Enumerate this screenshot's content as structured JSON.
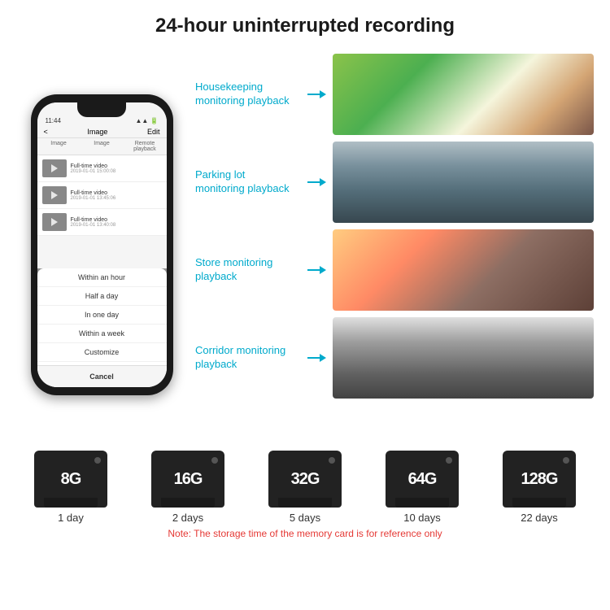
{
  "header": {
    "title": "24-hour uninterrupted recording"
  },
  "phone": {
    "time": "11:44",
    "screen_title": "Image",
    "edit_label": "Edit",
    "back_label": "<",
    "tabs": [
      "Image",
      "Image",
      "Remote playback"
    ],
    "list_items": [
      {
        "label": "Full-time video",
        "date": "2019-01-01 15:00:08"
      },
      {
        "label": "Full-time video",
        "date": "2019-01-01 13:45:06"
      },
      {
        "label": "Full-time video",
        "date": "2019-01-01 13:40:08"
      }
    ],
    "dropdown": {
      "items": [
        "Within an hour",
        "Half a day",
        "In one day",
        "Within a week",
        "Customize"
      ],
      "cancel_label": "Cancel"
    }
  },
  "monitoring": [
    {
      "label": "Housekeeping\nmonitoring playback",
      "img_class": "img-housekeeping"
    },
    {
      "label": "Parking lot\nmonitoring playback",
      "img_class": "img-parking"
    },
    {
      "label": "Store monitoring\nplayback",
      "img_class": "img-store"
    },
    {
      "label": "Corridor monitoring\nplayback",
      "img_class": "img-corridor"
    }
  ],
  "cards": [
    {
      "size": "8G",
      "days": "1 day"
    },
    {
      "size": "16G",
      "days": "2 days"
    },
    {
      "size": "32G",
      "days": "5 days"
    },
    {
      "size": "64G",
      "days": "10 days"
    },
    {
      "size": "128G",
      "days": "22 days"
    }
  ],
  "note": "Note: The storage time of the memory card is for reference only"
}
